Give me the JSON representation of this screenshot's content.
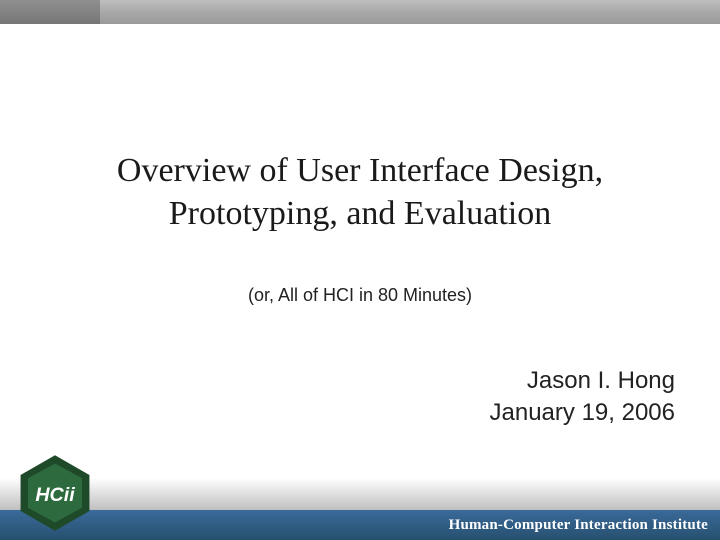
{
  "slide": {
    "title_line1": "Overview of User Interface Design,",
    "title_line2": "Prototyping, and Evaluation",
    "subtitle": "(or, All of HCI in 80 Minutes)",
    "author": "Jason I. Hong",
    "date": "January 19, 2006"
  },
  "footer": {
    "institute": "Human-Computer Interaction Institute",
    "logo_text": "HCii"
  }
}
